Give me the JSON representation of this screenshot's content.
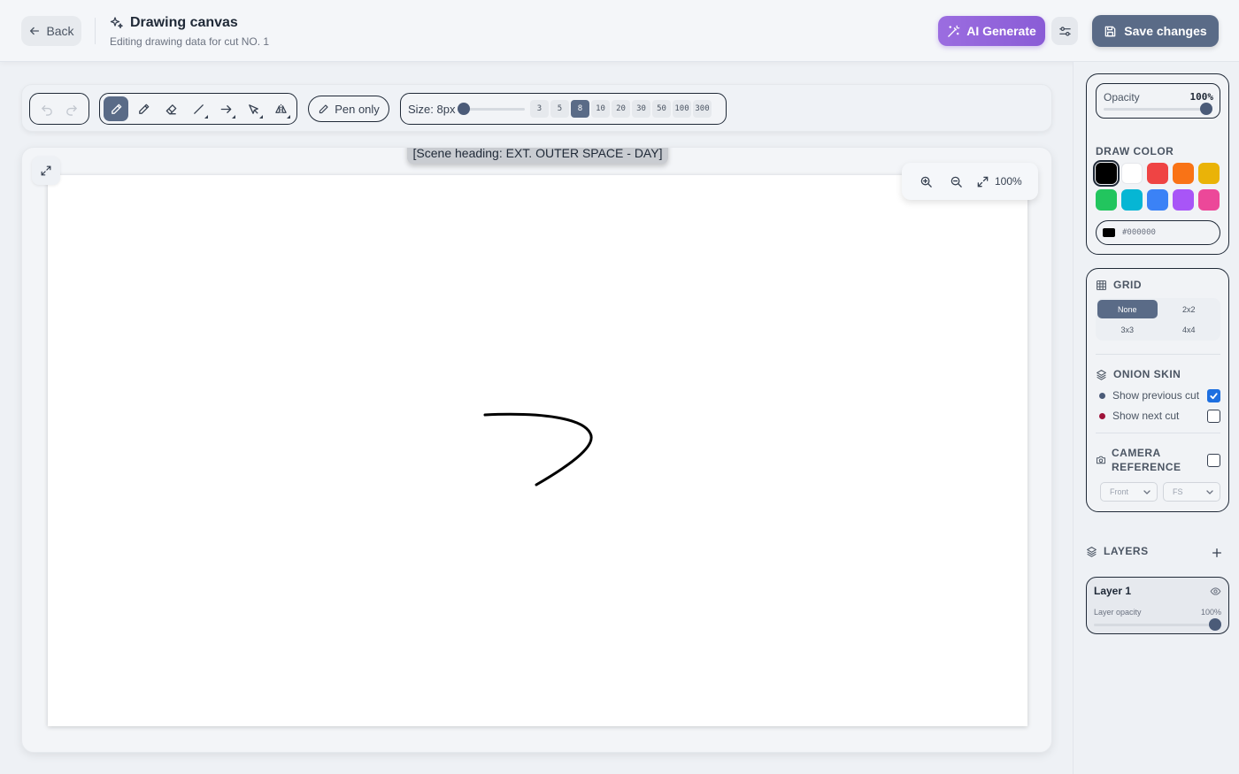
{
  "header": {
    "back_label": "Back",
    "title": "Drawing canvas",
    "subtitle": "Editing drawing data for cut NO. 1",
    "ai_label": "AI Generate",
    "save_label": "Save changes"
  },
  "toolbar": {
    "tools": [
      {
        "name": "pen-tool",
        "icon": "pen-icon",
        "active": true
      },
      {
        "name": "pencil-tool",
        "icon": "pencil-icon",
        "active": false
      },
      {
        "name": "eraser-tool",
        "icon": "eraser-icon",
        "active": false
      },
      {
        "name": "line-tool",
        "icon": "line-icon",
        "active": false
      },
      {
        "name": "arrow-tool",
        "icon": "arrow-icon",
        "active": false
      },
      {
        "name": "select-tool",
        "icon": "select-icon",
        "active": false
      },
      {
        "name": "mirror-tool",
        "icon": "mirror-icon",
        "active": false
      }
    ],
    "pen_only_label": "Pen only",
    "size_label": "Size: 8px",
    "size_options": [
      "3",
      "5",
      "8",
      "10",
      "20",
      "30",
      "50",
      "100",
      "300"
    ],
    "size_selected": "8"
  },
  "canvas": {
    "scene_heading": "[Scene heading: EXT. OUTER SPACE - DAY]",
    "zoom_label": "100%",
    "stroke_color": "#000000"
  },
  "panel": {
    "opacity_label": "Opacity",
    "opacity_value": "100%",
    "opacity_level": 1.0,
    "draw_color_label": "DRAW COLOR",
    "colors": [
      "#000000",
      "#ffffff",
      "#ef4444",
      "#f97316",
      "#eab308",
      "#22c55e",
      "#06b6d4",
      "#3b82f6",
      "#a855f7",
      "#ec4899"
    ],
    "selected_color": "#000000",
    "hex_value": "#000000",
    "grid_label": "GRID",
    "grid_options": [
      "None",
      "2x2",
      "3x3",
      "4x4"
    ],
    "grid_selected": "None",
    "onion_label": "ONION SKIN",
    "show_prev_label": "Show previous cut",
    "show_prev_checked": true,
    "show_next_label": "Show next cut",
    "show_next_checked": false,
    "prev_dot_color": "#4b5b78",
    "next_dot_color": "#9f1239",
    "camera_label": "CAMERA REFERENCE",
    "camera_checked": false,
    "camera_view": "Front",
    "camera_shot": "FS",
    "layers_label": "LAYERS",
    "layers": [
      {
        "name": "Layer 1",
        "opacity_label": "Layer opacity",
        "opacity_value": "100%",
        "opacity_level": 1.0
      }
    ]
  }
}
